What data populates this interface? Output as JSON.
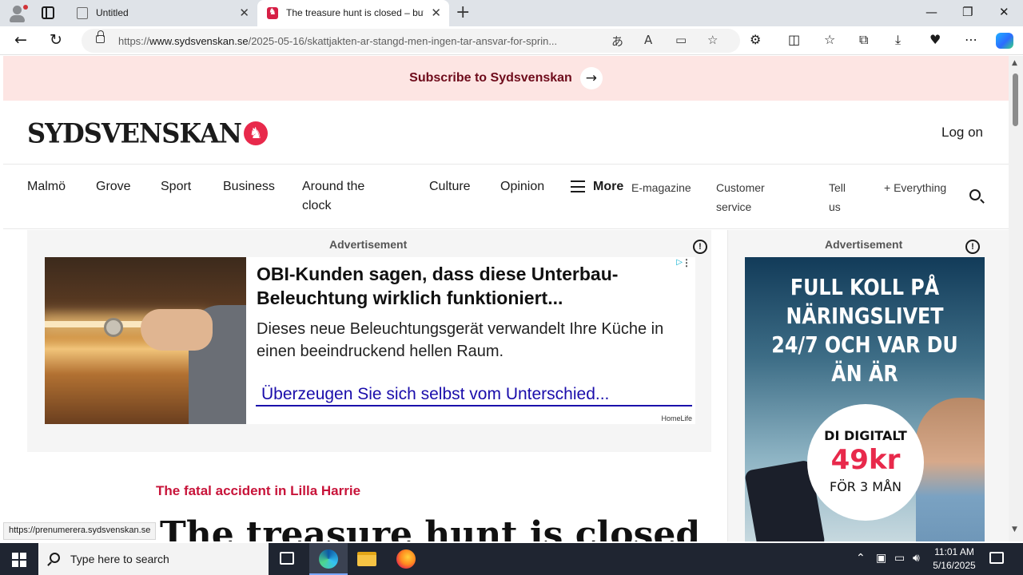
{
  "browser": {
    "tabs": [
      {
        "title": "Untitled",
        "active": false
      },
      {
        "title": "The treasure hunt is closed – but no one is taking responsibility",
        "active": true
      }
    ],
    "url": {
      "prefix": "https://",
      "domain": "www.sydsvenskan.se",
      "path": "/2025-05-16/skattjakten-ar-stangd-men-ingen-tar-ansvar-for-sprin..."
    },
    "accent": "#dfe3e8"
  },
  "page": {
    "subscribe_label": "Subscribe to Sydsvenskan",
    "logo_text": "SYDSVENSKAN",
    "login_label": "Log on",
    "nav": {
      "main": [
        "Malmö",
        "Grove",
        "Sport",
        "Business",
        "Around the clock",
        "Culture",
        "Opinion"
      ],
      "more_label": "More",
      "secondary": [
        "E-magazine",
        "Customer service",
        "Tell us",
        "+ Everything"
      ]
    },
    "ad_main": {
      "label": "Advertisement",
      "headline": "OBI-Kunden sagen, dass diese Unterbau-Beleuchtung wirklich funktioniert...",
      "body": "Dieses neue Beleuchtungsgerät verwandelt Ihre Küche in einen beeindruckend hellen Raum.",
      "link": "Überzeugen Sie sich selbst vom Unterschied...",
      "brand": "HomeLife"
    },
    "ad_side": {
      "label": "Advertisement",
      "headline": "FULL KOLL PÅ NÄRINGSLIVET 24/7 OCH VAR DU ÄN ÄR",
      "badge_top": "DI DIGITALT",
      "badge_price": "49kr",
      "badge_bottom": "FÖR 3 MÅN"
    },
    "kicker": "The fatal accident in Lilla Harrie",
    "headline": "The treasure hunt is closed",
    "status_url": "https://prenumerera.sydsvenskan.se",
    "brand_color": "#e8294b"
  },
  "taskbar": {
    "search_placeholder": "Type here to search",
    "time": "11:01 AM",
    "date": "5/16/2025"
  }
}
